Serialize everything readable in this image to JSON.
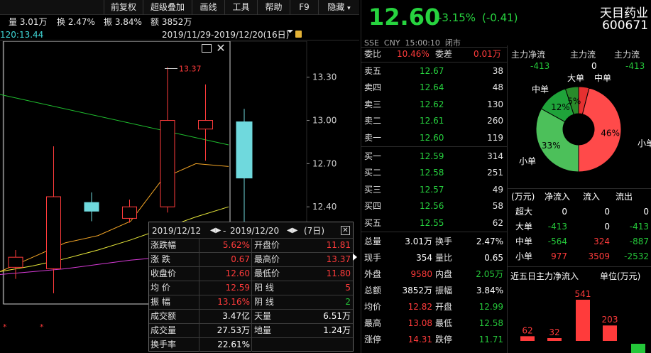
{
  "toolbar": {
    "items": [
      "前复权",
      "超级叠加",
      "画线",
      "工具",
      "帮助",
      "F9",
      "隐藏"
    ]
  },
  "stats": {
    "volume": "量 3.01万",
    "turnover": "换 2.47%",
    "amplitude": "振 3.84%",
    "amount": "额 3852万"
  },
  "chart_header": {
    "ma_label": "120:13.44",
    "range": "2019/11/29-2019/12/20(16日)"
  },
  "chart_data": {
    "type": "candlestick",
    "y_ticks": [
      "13.30",
      "13.00",
      "12.70",
      "12.40"
    ],
    "ylim": [
      11.75,
      13.55
    ],
    "marker_label": "13.37",
    "candles": [
      {
        "o": 12.05,
        "c": 11.98,
        "h": 12.1,
        "l": 11.9,
        "up": false
      },
      {
        "o": 11.97,
        "c": 12.47,
        "h": 12.82,
        "l": 11.8,
        "up": true
      },
      {
        "o": 12.43,
        "c": 12.37,
        "h": 12.5,
        "l": 12.3,
        "up": false
      },
      {
        "o": 12.32,
        "c": 12.4,
        "h": 12.45,
        "l": 12.29,
        "up": true
      },
      {
        "o": 12.4,
        "c": 13.0,
        "h": 13.37,
        "l": 12.36,
        "up": true
      },
      {
        "o": 13.0,
        "c": 12.94,
        "h": 13.25,
        "l": 12.72,
        "up": false
      },
      {
        "o": 12.99,
        "c": 12.6,
        "h": 13.08,
        "l": 11.8,
        "up": false
      }
    ],
    "note": "Chart partially shown; last candle is the 2019/12/20 session."
  },
  "tooltip": {
    "from": "2019/12/12",
    "to": "2019/12/20",
    "days": "(7日)",
    "rows": [
      {
        "l1": "涨跌幅",
        "v1": "5.62%",
        "c1": "red",
        "l2": "开盘价",
        "v2": "11.81",
        "c2": "red"
      },
      {
        "l1": "涨 跌",
        "v1": "0.67",
        "c1": "red",
        "l2": "最高价",
        "v2": "13.37",
        "c2": "red"
      },
      {
        "l1": "收盘价",
        "v1": "12.60",
        "c1": "red",
        "l2": "最低价",
        "v2": "11.80",
        "c2": "red"
      },
      {
        "l1": "均 价",
        "v1": "12.59",
        "c1": "red",
        "l2": "阳 线",
        "v2": "5",
        "c2": "red"
      },
      {
        "l1": "振 幅",
        "v1": "13.16%",
        "c1": "red",
        "l2": "阴 线",
        "v2": "2",
        "c2": "green"
      },
      {
        "l1": "成交额",
        "v1": "3.47亿",
        "c1": "white",
        "l2": "天量",
        "v2": "6.51万",
        "c2": "white"
      },
      {
        "l1": "成交量",
        "v1": "27.53万",
        "c1": "white",
        "l2": "地量",
        "v2": "1.24万",
        "c2": "white"
      },
      {
        "l1": "换手率",
        "v1": "22.61%",
        "c1": "white",
        "l2": "",
        "v2": "",
        "c2": "white"
      }
    ]
  },
  "quote": {
    "price": "12.60",
    "change_pct": "-3.15%",
    "change": "(-0.41)",
    "name": "天目药业",
    "code": "600671",
    "meta": "SSE  CNY  15:00:10  闭市",
    "weibi_label": "委比",
    "weibi": "10.46%",
    "weicha_label": "委差",
    "weicha": "0.01万",
    "asks": [
      {
        "label": "卖五",
        "price": "12.67",
        "vol": "38"
      },
      {
        "label": "卖四",
        "price": "12.64",
        "vol": "48"
      },
      {
        "label": "卖三",
        "price": "12.62",
        "vol": "130"
      },
      {
        "label": "卖二",
        "price": "12.61",
        "vol": "260"
      },
      {
        "label": "卖一",
        "price": "12.60",
        "vol": "119"
      }
    ],
    "bids": [
      {
        "label": "买一",
        "price": "12.59",
        "vol": "314"
      },
      {
        "label": "买二",
        "price": "12.58",
        "vol": "251"
      },
      {
        "label": "买三",
        "price": "12.57",
        "vol": "49"
      },
      {
        "label": "买四",
        "price": "12.56",
        "vol": "58"
      },
      {
        "label": "买五",
        "price": "12.55",
        "vol": "62"
      }
    ],
    "stats_rows": [
      {
        "l1": "总量",
        "v1": "3.01万",
        "c1": "white",
        "l2": "换手",
        "v2": "2.47%",
        "c2": "white"
      },
      {
        "l1": "现手",
        "v1": "354",
        "c1": "white",
        "l2": "量比",
        "v2": "0.65",
        "c2": "white"
      },
      {
        "l1": "外盘",
        "v1": "9580",
        "c1": "red",
        "l2": "内盘",
        "v2": "2.05万",
        "c2": "green"
      },
      {
        "l1": "总额",
        "v1": "3852万",
        "c1": "white",
        "l2": "振幅",
        "v2": "3.84%",
        "c2": "white"
      },
      {
        "l1": "均价",
        "v1": "12.82",
        "c1": "red",
        "l2": "开盘",
        "v2": "12.99",
        "c2": "green"
      },
      {
        "l1": "最高",
        "v1": "13.08",
        "c1": "red",
        "l2": "最低",
        "v2": "12.58",
        "c2": "green"
      },
      {
        "l1": "涨停",
        "v1": "14.31",
        "c1": "red",
        "l2": "跌停",
        "v2": "11.71",
        "c2": "green"
      }
    ]
  },
  "capital": {
    "headers": [
      "主力净流",
      "主力流",
      "主力流"
    ],
    "values": [
      "-413",
      "0",
      "-413"
    ],
    "pie": {
      "labels": [
        "大单",
        "中单",
        "中单",
        "小单",
        "小单"
      ],
      "slices": [
        {
          "name": "大单",
          "pct": "5%",
          "color": "#2a8a2a",
          "frac": 0.05
        },
        {
          "name": "中单",
          "pct": "12%",
          "color": "#1fa33a",
          "frac": 0.12
        },
        {
          "name": "小单",
          "pct": "33%",
          "color": "#4cc05a",
          "frac": 0.33
        },
        {
          "name": "中单",
          "pct": "",
          "color": "#e63030",
          "frac": 0.04
        },
        {
          "name": "小单",
          "pct": "46%",
          "color": "#ff4a4a",
          "frac": 0.46
        }
      ]
    },
    "flow_table": {
      "headers": [
        "(万元)",
        "净流入",
        "流入",
        "流出"
      ],
      "rows": [
        {
          "name": "超大",
          "net": "0",
          "in": "0",
          "out": "0",
          "nc": "white",
          "ic": "white",
          "oc": "white"
        },
        {
          "name": "大单",
          "net": "-413",
          "in": "0",
          "out": "-413",
          "nc": "green",
          "ic": "white",
          "oc": "green"
        },
        {
          "name": "中单",
          "net": "-564",
          "in": "324",
          "out": "-887",
          "nc": "green",
          "ic": "red",
          "oc": "green"
        },
        {
          "name": "小单",
          "net": "977",
          "in": "3509",
          "out": "-2532",
          "nc": "red",
          "ic": "red",
          "oc": "green"
        }
      ]
    },
    "five_day_title": "近五日主力净流入",
    "five_day_unit": "单位(万元)",
    "five_day": [
      {
        "v": 62,
        "label": "62",
        "color": "#ff3b3b"
      },
      {
        "v": 32,
        "label": "32",
        "color": "#ff3b3b"
      },
      {
        "v": 541,
        "label": "541",
        "color": "#ff3b3b"
      },
      {
        "v": 203,
        "label": "203",
        "color": "#ff3b3b"
      },
      {
        "v": -40,
        "label": "",
        "color": "#25c73a"
      }
    ]
  }
}
